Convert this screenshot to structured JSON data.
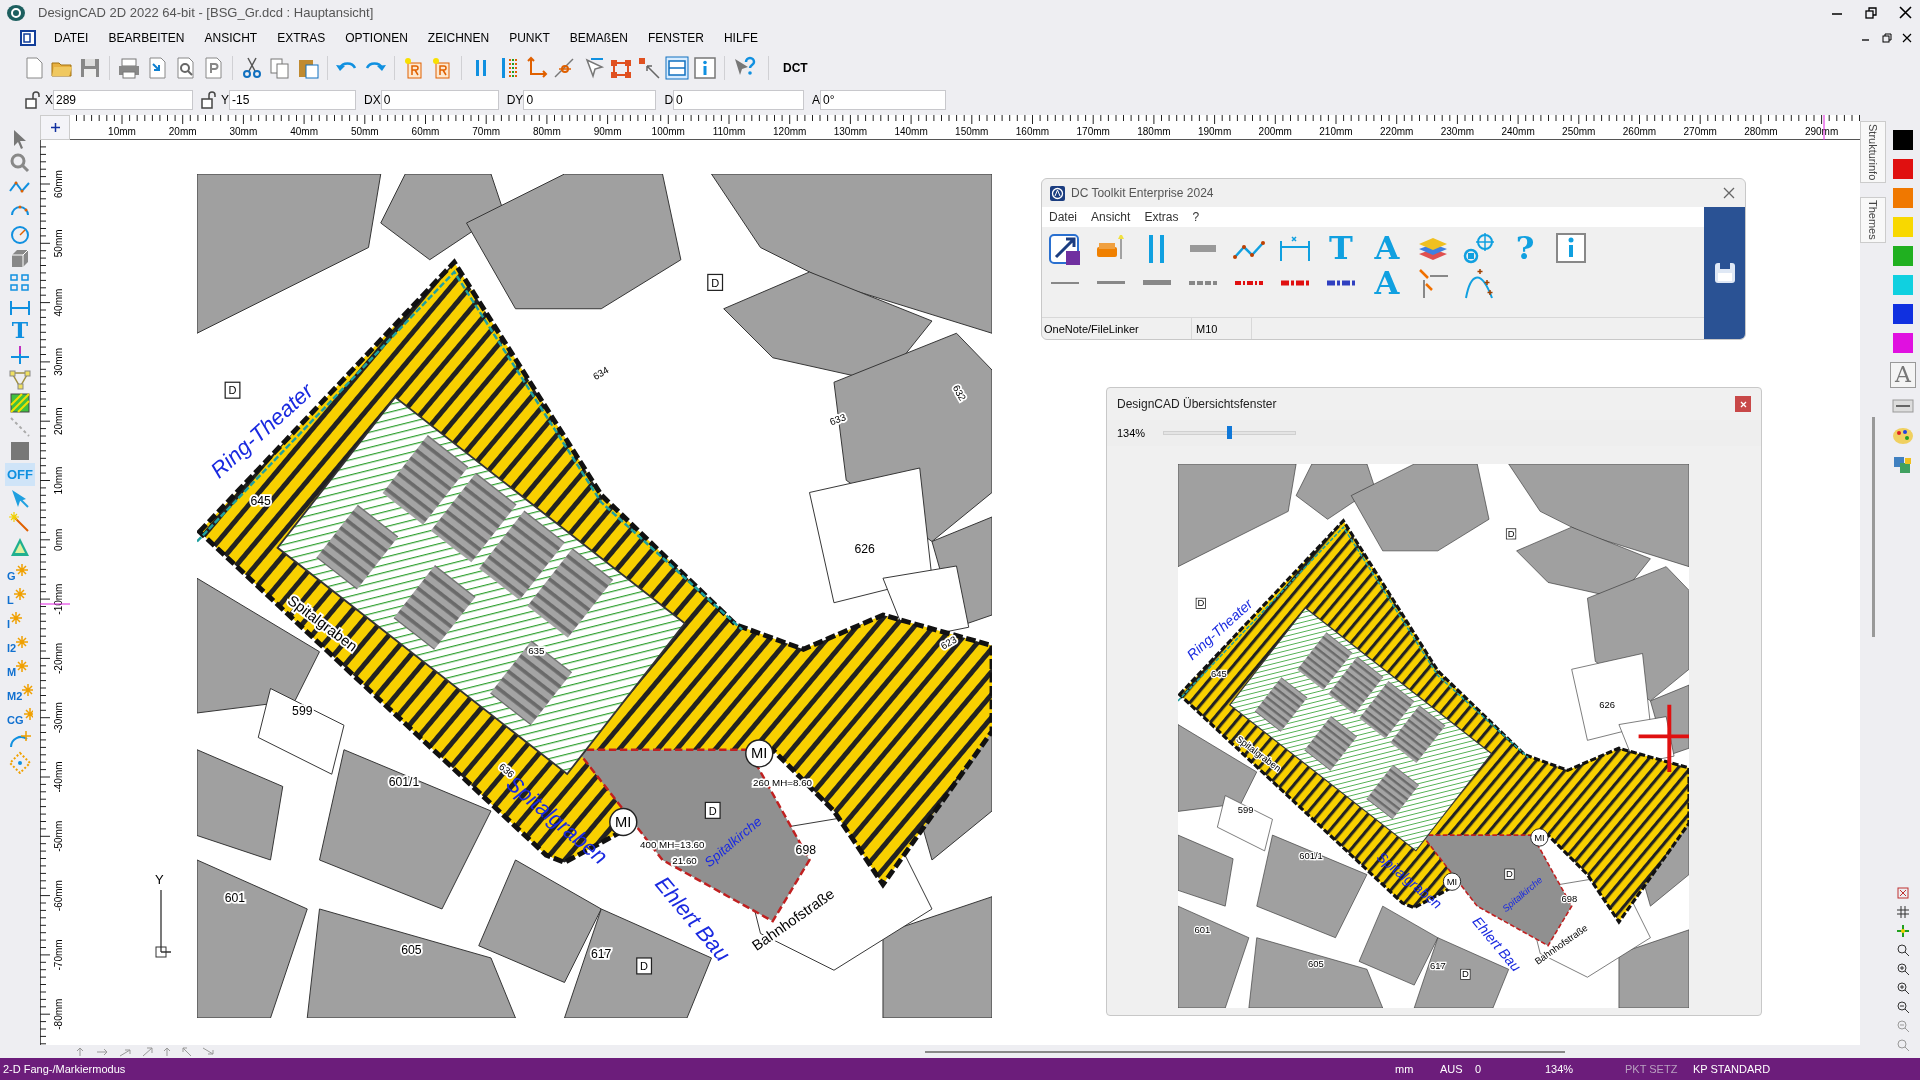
{
  "window": {
    "title": "DesignCAD 2D 2022 64-bit - [BSG_Gr.dcd : Hauptansicht]"
  },
  "menu": [
    "DATEI",
    "BEARBEITEN",
    "ANSICHT",
    "EXTRAS",
    "OPTIONEN",
    "ZEICHNEN",
    "PUNKT",
    "BEMAßEN",
    "FENSTER",
    "HILFE"
  ],
  "toolbar": {
    "text_button": "DCT"
  },
  "coordinates": [
    {
      "label": "X",
      "value": "289",
      "lock": true
    },
    {
      "label": "Y",
      "value": "-15",
      "lock": true
    },
    {
      "label": "DX",
      "value": "0",
      "lock": false
    },
    {
      "label": "DY",
      "value": "0",
      "lock": false
    },
    {
      "label": "D",
      "value": "0",
      "lock": false
    },
    {
      "label": "A",
      "value": "0°",
      "lock": false
    }
  ],
  "left_toolbar": [
    {
      "kind": "pointer"
    },
    {
      "kind": "zoom"
    },
    {
      "kind": "polyline"
    },
    {
      "kind": "arc"
    },
    {
      "kind": "circle"
    },
    {
      "kind": "cube"
    },
    {
      "kind": "grid"
    },
    {
      "kind": "dimension"
    },
    {
      "kind": "glyph",
      "label": "T"
    },
    {
      "kind": "cross"
    },
    {
      "kind": "triangle"
    },
    {
      "kind": "hatch"
    },
    {
      "kind": "dashline"
    },
    {
      "kind": "square"
    },
    {
      "kind": "toggle",
      "label": "OFF"
    },
    {
      "kind": "arrow"
    },
    {
      "kind": "wand"
    },
    {
      "kind": "prism"
    },
    {
      "kind": "snap",
      "label": "G"
    },
    {
      "kind": "snap",
      "label": "L"
    },
    {
      "kind": "snap",
      "label": "I"
    },
    {
      "kind": "snap",
      "label": "I2"
    },
    {
      "kind": "snap",
      "label": "M"
    },
    {
      "kind": "snap",
      "label": "M2"
    },
    {
      "kind": "snap",
      "label": "CG"
    },
    {
      "kind": "arc2"
    },
    {
      "kind": "diamond"
    }
  ],
  "ruler_h": [
    "10mm",
    "20mm",
    "30mm",
    "40mm",
    "50mm",
    "60mm",
    "70mm",
    "80mm",
    "90mm",
    "100mm",
    "110mm",
    "120mm",
    "130mm",
    "140mm",
    "150mm",
    "160mm",
    "170mm",
    "180mm",
    "190mm",
    "200mm",
    "210mm",
    "220mm",
    "230mm",
    "240mm",
    "250mm",
    "260mm",
    "270mm",
    "280mm",
    "290mm"
  ],
  "ruler_v": [
    "60mm",
    "50mm",
    "40mm",
    "30mm",
    "20mm",
    "10mm",
    "0mm",
    "-10mm",
    "-20mm",
    "-30mm",
    "-40mm",
    "-50mm",
    "-60mm",
    "-70mm",
    "-80mm"
  ],
  "map_labels": [
    {
      "text": "Ring-Theater",
      "kind": "blue"
    },
    {
      "text": "645",
      "kind": "parcel"
    },
    {
      "text": "Spitalgraben",
      "kind": "street"
    },
    {
      "text": "634",
      "kind": "small"
    },
    {
      "text": "632",
      "kind": "small"
    },
    {
      "text": "633",
      "kind": "small"
    },
    {
      "text": "626",
      "kind": "parcel"
    },
    {
      "text": "623",
      "kind": "small"
    },
    {
      "text": "635",
      "kind": "small"
    },
    {
      "text": "599",
      "kind": "parcel"
    },
    {
      "text": "601/1",
      "kind": "parcel"
    },
    {
      "text": "601",
      "kind": "parcel"
    },
    {
      "text": "605",
      "kind": "parcel"
    },
    {
      "text": "617",
      "kind": "parcel"
    },
    {
      "text": "636",
      "kind": "small"
    },
    {
      "text": "698",
      "kind": "parcel"
    },
    {
      "text": "Bahnhofstraße",
      "kind": "street"
    },
    {
      "text": "Spitalgraben",
      "kind": "blue"
    },
    {
      "text": "Ehlert Bau",
      "kind": "blue"
    },
    {
      "text": "Spitalkirche",
      "kind": "bluesmall"
    },
    {
      "text": "MI",
      "kind": "circle"
    },
    {
      "text": "MI",
      "kind": "circle"
    },
    {
      "text": "400 MH=13.60",
      "kind": "tiny"
    },
    {
      "text": "21.60",
      "kind": "tiny"
    },
    {
      "text": "260 MH=8.60",
      "kind": "tiny"
    },
    {
      "text": "D",
      "kind": "box"
    },
    {
      "text": "D",
      "kind": "box"
    },
    {
      "text": "D",
      "kind": "box"
    },
    {
      "text": "D",
      "kind": "box"
    }
  ],
  "axis_label": "Y",
  "toolkit": {
    "title": "DC Toolkit Enterprise 2024",
    "menu": [
      "Datei",
      "Ansicht",
      "Extras",
      "?"
    ],
    "tools": [
      {
        "kind": "link"
      },
      {
        "kind": "sofa"
      },
      {
        "kind": "pause"
      },
      {
        "kind": "bar"
      },
      {
        "kind": "polyline"
      },
      {
        "kind": "dimension"
      },
      {
        "kind": "glyph",
        "label": "T"
      },
      {
        "kind": "glyph",
        "label": "A"
      },
      {
        "kind": "layers"
      },
      {
        "kind": "target"
      },
      {
        "kind": "glyph",
        "label": "?"
      },
      {
        "kind": "info"
      }
    ],
    "tools2": [
      {
        "kind": "line1"
      },
      {
        "kind": "line2"
      },
      {
        "kind": "line3"
      },
      {
        "kind": "dash"
      },
      {
        "kind": "dashred"
      },
      {
        "kind": "dashred2"
      },
      {
        "kind": "dashblue"
      },
      {
        "kind": "glyph",
        "label": "A"
      },
      {
        "kind": "chamfer"
      },
      {
        "kind": "curve"
      }
    ],
    "status": [
      "OneNote/FileLinker",
      "M10"
    ]
  },
  "overview": {
    "title": "DesignCAD Übersichtsfenster",
    "zoom": "134%",
    "level": 0.5,
    "map_labels": [
      {
        "text": "Ring-Theater",
        "kind": "blue"
      },
      {
        "text": "645",
        "kind": "parcel"
      },
      {
        "text": "Spitalgraben",
        "kind": "street"
      },
      {
        "text": "626",
        "kind": "parcel"
      },
      {
        "text": "599",
        "kind": "parcel"
      },
      {
        "text": "601/1",
        "kind": "parcel"
      },
      {
        "text": "601",
        "kind": "parcel"
      },
      {
        "text": "605",
        "kind": "parcel"
      },
      {
        "text": "617",
        "kind": "parcel"
      },
      {
        "text": "698",
        "kind": "parcel"
      },
      {
        "text": "Bahnhofstraße",
        "kind": "street"
      },
      {
        "text": "Spitalgraben",
        "kind": "blue"
      },
      {
        "text": "Ehlert Bau",
        "kind": "blue"
      },
      {
        "text": "Spitalkirche",
        "kind": "bluesmall"
      },
      {
        "text": "MI",
        "kind": "circle"
      },
      {
        "text": "MI",
        "kind": "circle"
      },
      {
        "text": "D",
        "kind": "box"
      },
      {
        "text": "D",
        "kind": "box"
      },
      {
        "text": "D",
        "kind": "box"
      },
      {
        "text": "D",
        "kind": "box"
      }
    ]
  },
  "right_panel": {
    "tabs": [
      "Strukturinfo",
      "Themes"
    ],
    "swatches": [
      {
        "color": "#000000"
      },
      {
        "color": "#e01010"
      },
      {
        "color": "#f07800"
      },
      {
        "color": "#f8d800"
      },
      {
        "color": "#20b020"
      },
      {
        "color": "#10d0e0"
      },
      {
        "color": "#1030e0"
      },
      {
        "color": "#e010e0"
      }
    ],
    "text_tool": "A"
  },
  "status_bar": [
    {
      "text": "2-D Fang-/Markiermodus",
      "disabled": false
    },
    {
      "text": "mm",
      "disabled": false
    },
    {
      "text": "AUS",
      "disabled": false
    },
    {
      "text": "0",
      "disabled": false
    },
    {
      "text": "134%",
      "disabled": false
    },
    {
      "text": "PKT SETZ",
      "disabled": true
    },
    {
      "text": "KP STANDARD",
      "disabled": false
    }
  ]
}
